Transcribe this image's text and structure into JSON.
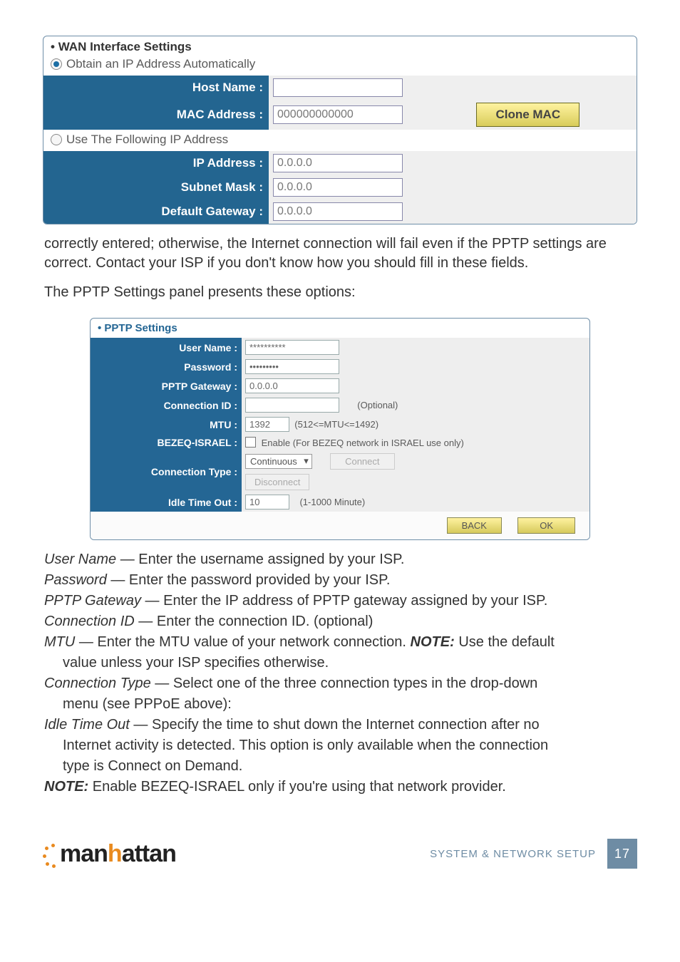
{
  "wan": {
    "title": "WAN Interface Settings",
    "opt_auto": "Obtain an IP Address Automatically",
    "opt_static": "Use The Following IP Address",
    "host_name_label": "Host Name :",
    "mac_label": "MAC Address :",
    "mac_value": "000000000000",
    "clone_btn": "Clone MAC",
    "ip_label": "IP Address :",
    "ip_value": "0.0.0.0",
    "subnet_label": "Subnet Mask :",
    "subnet_value": "0.0.0.0",
    "gw_label": "Default Gateway :",
    "gw_value": "0.0.0.0"
  },
  "para1": "correctly entered; otherwise, the Internet connection will fail even if the PPTP settings are correct. Contact your ISP if you don't know how you should fill in these fields.",
  "para2": "The PPTP Settings panel presents these options:",
  "pptp": {
    "title": "PPTP Settings",
    "user_label": "User Name :",
    "user_value": "**********",
    "pwd_label": "Password :",
    "pwd_value": "•••••••••",
    "gw_label": "PPTP Gateway :",
    "gw_value": "0.0.0.0",
    "cid_label": "Connection ID :",
    "cid_note": "(Optional)",
    "mtu_label": "MTU :",
    "mtu_value": "1392",
    "mtu_note": "(512<=MTU<=1492)",
    "bezeq_label": "BEZEQ-ISRAEL :",
    "bezeq_text": "Enable (For BEZEQ network in ISRAEL use only)",
    "ctype_label": "Connection Type :",
    "ctype_value": "Continuous",
    "connect_btn": "Connect",
    "disconnect_btn": "Disconnect",
    "idle_label": "Idle Time Out :",
    "idle_value": "10",
    "idle_note": "(1-1000 Minute)",
    "back_btn": "BACK",
    "ok_btn": "OK"
  },
  "defs": {
    "user_t": "User Name",
    "user_d": " — Enter the username assigned by your ISP.",
    "pwd_t": "Password",
    "pwd_d": " — Enter the password provided by your ISP.",
    "gw_t": "PPTP Gateway",
    "gw_d": " — Enter the IP address of PPTP gateway assigned by your ISP.",
    "cid_t": "Connection ID",
    "cid_d": " — Enter the connection ID. (optional)",
    "mtu_t": "MTU",
    "mtu_d1": " — Enter the MTU value of your network connection. ",
    "mtu_note": "NOTE:",
    "mtu_d2": " Use the default",
    "mtu_sub": "value unless your ISP specifies otherwise.",
    "ctype_t": "Connection Type",
    "ctype_d": " — Select one of the three connection types in the drop-down",
    "ctype_sub": "menu (see PPPoE above):",
    "idle_t": "Idle Time Out",
    "idle_d": " — Specify the time to shut down the Internet connection after no",
    "idle_sub1": "Internet activity is detected. This option is only available when the connection",
    "idle_sub2": "type is Connect on Demand.",
    "note_t": "NOTE:",
    "note_d": " Enable BEZEQ-ISRAEL only if you're using that network provider."
  },
  "footer": {
    "brand_m": "man",
    "brand_h": "h",
    "brand_rest": "attan",
    "section": "SYSTEM & NETWORK SETUP",
    "page": "17"
  }
}
